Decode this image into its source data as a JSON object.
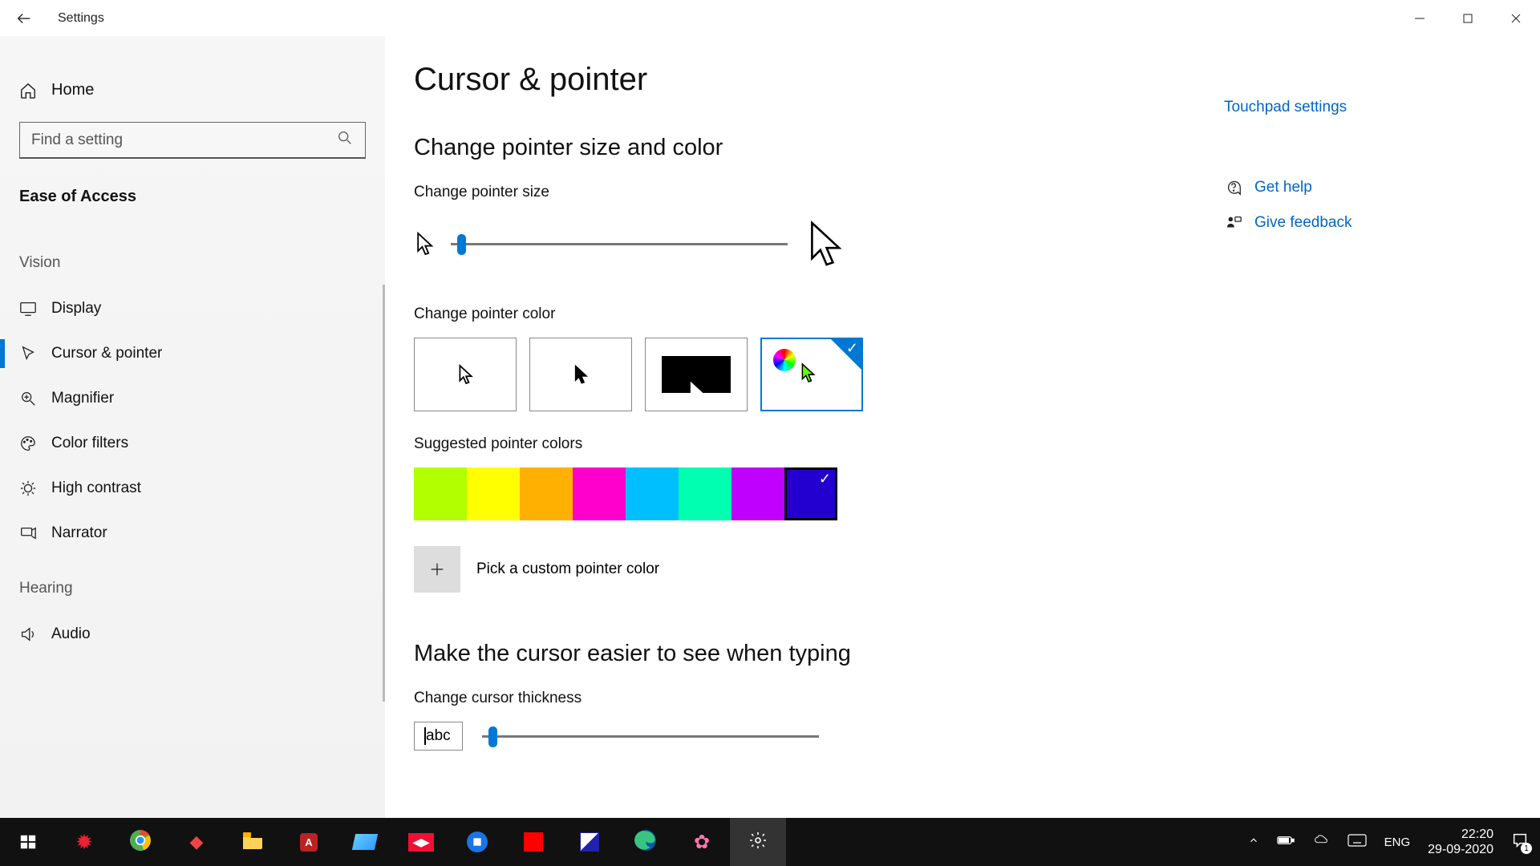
{
  "app_title": "Settings",
  "sidebar": {
    "home": "Home",
    "search_placeholder": "Find a setting",
    "heading": "Ease of Access",
    "groups": [
      {
        "label": "Vision",
        "items": [
          {
            "id": "display",
            "label": "Display"
          },
          {
            "id": "cursor-pointer",
            "label": "Cursor & pointer",
            "active": true
          },
          {
            "id": "magnifier",
            "label": "Magnifier"
          },
          {
            "id": "color-filters",
            "label": "Color filters"
          },
          {
            "id": "high-contrast",
            "label": "High contrast"
          },
          {
            "id": "narrator",
            "label": "Narrator"
          }
        ]
      },
      {
        "label": "Hearing",
        "items": [
          {
            "id": "audio",
            "label": "Audio"
          }
        ]
      }
    ]
  },
  "page": {
    "title": "Cursor & pointer",
    "section1_title": "Change pointer size and color",
    "size_label": "Change pointer size",
    "size_value_pct": 2,
    "color_label": "Change pointer color",
    "color_tiles": [
      {
        "id": "white",
        "selected": false
      },
      {
        "id": "black",
        "selected": false
      },
      {
        "id": "inverted",
        "selected": false
      },
      {
        "id": "custom",
        "selected": true
      }
    ],
    "sugg_label": "Suggested pointer colors",
    "sugg_colors": [
      {
        "hex": "#b2ff00",
        "selected": false
      },
      {
        "hex": "#ffff00",
        "selected": false
      },
      {
        "hex": "#ffb000",
        "selected": false
      },
      {
        "hex": "#ff00cc",
        "selected": false
      },
      {
        "hex": "#00bfff",
        "selected": false
      },
      {
        "hex": "#00ffb0",
        "selected": false
      },
      {
        "hex": "#c000ff",
        "selected": false
      },
      {
        "hex": "#2400d0",
        "selected": true
      }
    ],
    "custom_label": "Pick a custom pointer color",
    "section2_title": "Make the cursor easier to see when typing",
    "thickness_label": "Change cursor thickness",
    "thickness_sample": "abc",
    "thickness_value_pct": 2
  },
  "right": {
    "touchpad": "Touchpad settings",
    "get_help": "Get help",
    "feedback": "Give feedback"
  },
  "taskbar": {
    "lang": "ENG",
    "time": "22:20",
    "date": "29-09-2020",
    "notif_count": "1"
  }
}
